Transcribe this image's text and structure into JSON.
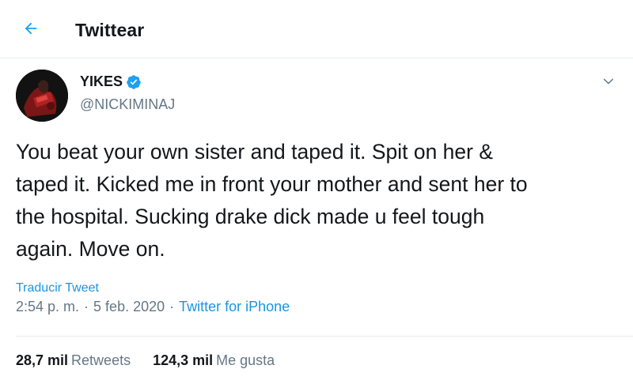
{
  "header": {
    "title": "Twittear",
    "back_icon": "arrow-left-icon",
    "accent_color": "#1da1f2"
  },
  "tweet": {
    "author": {
      "display_name": "YIKES",
      "handle": "@NICKIMINAJ",
      "verified": true,
      "verified_icon": "verified-badge-icon"
    },
    "menu_icon": "chevron-down-icon",
    "text": "You beat your own sister and taped it. Spit on her &\ntaped it. Kicked me in front your mother and sent her to\nthe hospital. Sucking drake dick made u feel tough\nagain. Move on.",
    "translate_label": "Traducir Tweet",
    "time": "2:54 p. m.",
    "date": "5 feb. 2020",
    "separator": "·",
    "source": "Twitter for iPhone",
    "stats": {
      "retweets_count": "28,7 mil",
      "retweets_label": "Retweets",
      "likes_count": "124,3 mil",
      "likes_label": "Me gusta"
    }
  }
}
